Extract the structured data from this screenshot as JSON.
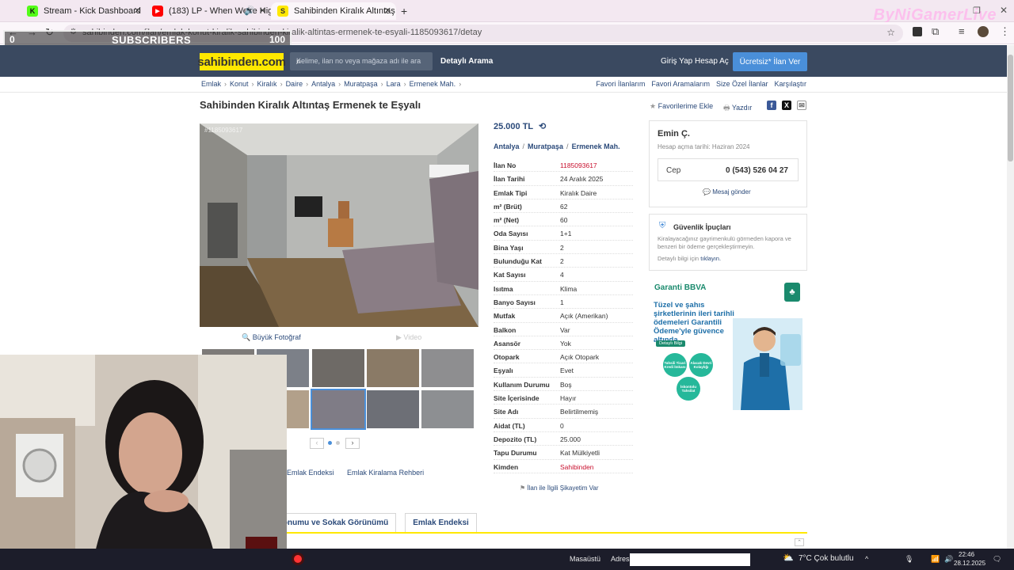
{
  "browser": {
    "tabs": [
      {
        "title": "Stream - Kick Dashboard",
        "favicon_color": "#53fc18",
        "favicon_letter": "K"
      },
      {
        "title": "(183) LP - When We're High",
        "favicon_color": "#ff0000",
        "favicon_letter": "▶"
      },
      {
        "title": "Sahibinden Kiralık Altıntaş Erme",
        "favicon_color": "#ffe800",
        "favicon_letter": "S"
      }
    ],
    "new_tab": "+",
    "url": "sahibinden.com/ilan/emlak-konut-kiralik-sahibinden-kiralik-altintas-ermenek-te-esyali-1185093617/detay"
  },
  "overlay": {
    "subs_left": "0",
    "subs_label": "SUBSCRIBERS",
    "subs_right": "100",
    "progress": 0,
    "watermark": "ByNiGamerLive"
  },
  "header": {
    "logo": "sahibinden.com",
    "search_placeholder": "Kelime, ilan no veya mağaza adı ile ara",
    "advanced_search": "Detaylı Arama",
    "login": "Giriş Yap",
    "register": "Hesap Aç",
    "post_ad": "Ücretsiz* İlan Ver"
  },
  "breadcrumb": [
    "Emlak",
    "Konut",
    "Kiralık",
    "Daire",
    "Antalya",
    "Muratpaşa",
    "Lara",
    "Ermenek Mah."
  ],
  "top_links": [
    "Favori İlanlarım",
    "Favori Aramalarım",
    "Size Özel İlanlar",
    "Karşılaştır"
  ],
  "listing": {
    "title": "Sahibinden Kiralık Altıntaş Ermenek te Eşyalı",
    "favorite": "Favorilerime Ekle",
    "print": "Yazdır",
    "photo_id": "#1185093617",
    "big_photo": "Büyük Fotoğraf",
    "video": "Video",
    "price": "25.000 TL",
    "location": [
      "Antalya",
      "Muratpaşa",
      "Ermenek Mah."
    ],
    "attributes": [
      {
        "k": "İlan No",
        "v": "1185093617",
        "red": true
      },
      {
        "k": "İlan Tarihi",
        "v": "24 Aralık 2025"
      },
      {
        "k": "Emlak Tipi",
        "v": "Kiralık Daire"
      },
      {
        "k": "m² (Brüt)",
        "v": "62"
      },
      {
        "k": "m² (Net)",
        "v": "60"
      },
      {
        "k": "Oda Sayısı",
        "v": "1+1"
      },
      {
        "k": "Bina Yaşı",
        "v": "2"
      },
      {
        "k": "Bulunduğu Kat",
        "v": "2"
      },
      {
        "k": "Kat Sayısı",
        "v": "4"
      },
      {
        "k": "Isıtma",
        "v": "Klima"
      },
      {
        "k": "Banyo Sayısı",
        "v": "1"
      },
      {
        "k": "Mutfak",
        "v": "Açık (Amerikan)"
      },
      {
        "k": "Balkon",
        "v": "Var"
      },
      {
        "k": "Asansör",
        "v": "Yok"
      },
      {
        "k": "Otopark",
        "v": "Açık Otopark"
      },
      {
        "k": "Eşyalı",
        "v": "Evet"
      },
      {
        "k": "Kullanım Durumu",
        "v": "Boş"
      },
      {
        "k": "Site İçerisinde",
        "v": "Hayır"
      },
      {
        "k": "Site Adı",
        "v": "Belirtilmemiş"
      },
      {
        "k": "Aidat (TL)",
        "v": "0"
      },
      {
        "k": "Depozito (TL)",
        "v": "25.000"
      },
      {
        "k": "Tapu Durumu",
        "v": "Kat Mülkiyetli"
      },
      {
        "k": "Kimden",
        "v": "Sahibinden",
        "red": true
      }
    ],
    "complaint": "İlan ile İlgili Şikayetim Var"
  },
  "seller": {
    "name": "Emin Ç.",
    "since": "Hesap açma tarihi: Haziran 2024",
    "phone_label": "Cep",
    "phone": "0 (543) 526 04 27",
    "message": "Mesaj gönder"
  },
  "security": {
    "title": "Güvenlik İpuçları",
    "text": "Kiralayacağınız gayrimenkulü görmeden kapora ve benzeri bir ödeme gerçekleştirmeyin.",
    "more_prefix": "Detaylı bilgi için",
    "more_link": "tıklayın."
  },
  "ad": {
    "brand": "Garanti BBVA",
    "text": "Tüzel ve şahıs şirketlerinin ileri tarihli ödemeleri Garantili Ödeme'yle güvence altında.",
    "button": "Detaylı Bilgi",
    "circles": [
      "Tahsili Ticari Kredi İmkanı",
      "Alacak Devri Kolaylığı",
      "İskontolu Tahsilat"
    ]
  },
  "lower": {
    "links": [
      "Emlak Endeksi",
      "Emlak Kiralama Rehberi"
    ],
    "tabs": [
      "Konumu ve Sokak Görünümü",
      "Emlak Endeksi"
    ]
  },
  "taskbar": {
    "desktop": "Masaüstü",
    "address_label": "Adres",
    "weather": "7°C  Çok bulutlu",
    "time": "22:46",
    "date": "28.12.2025"
  }
}
